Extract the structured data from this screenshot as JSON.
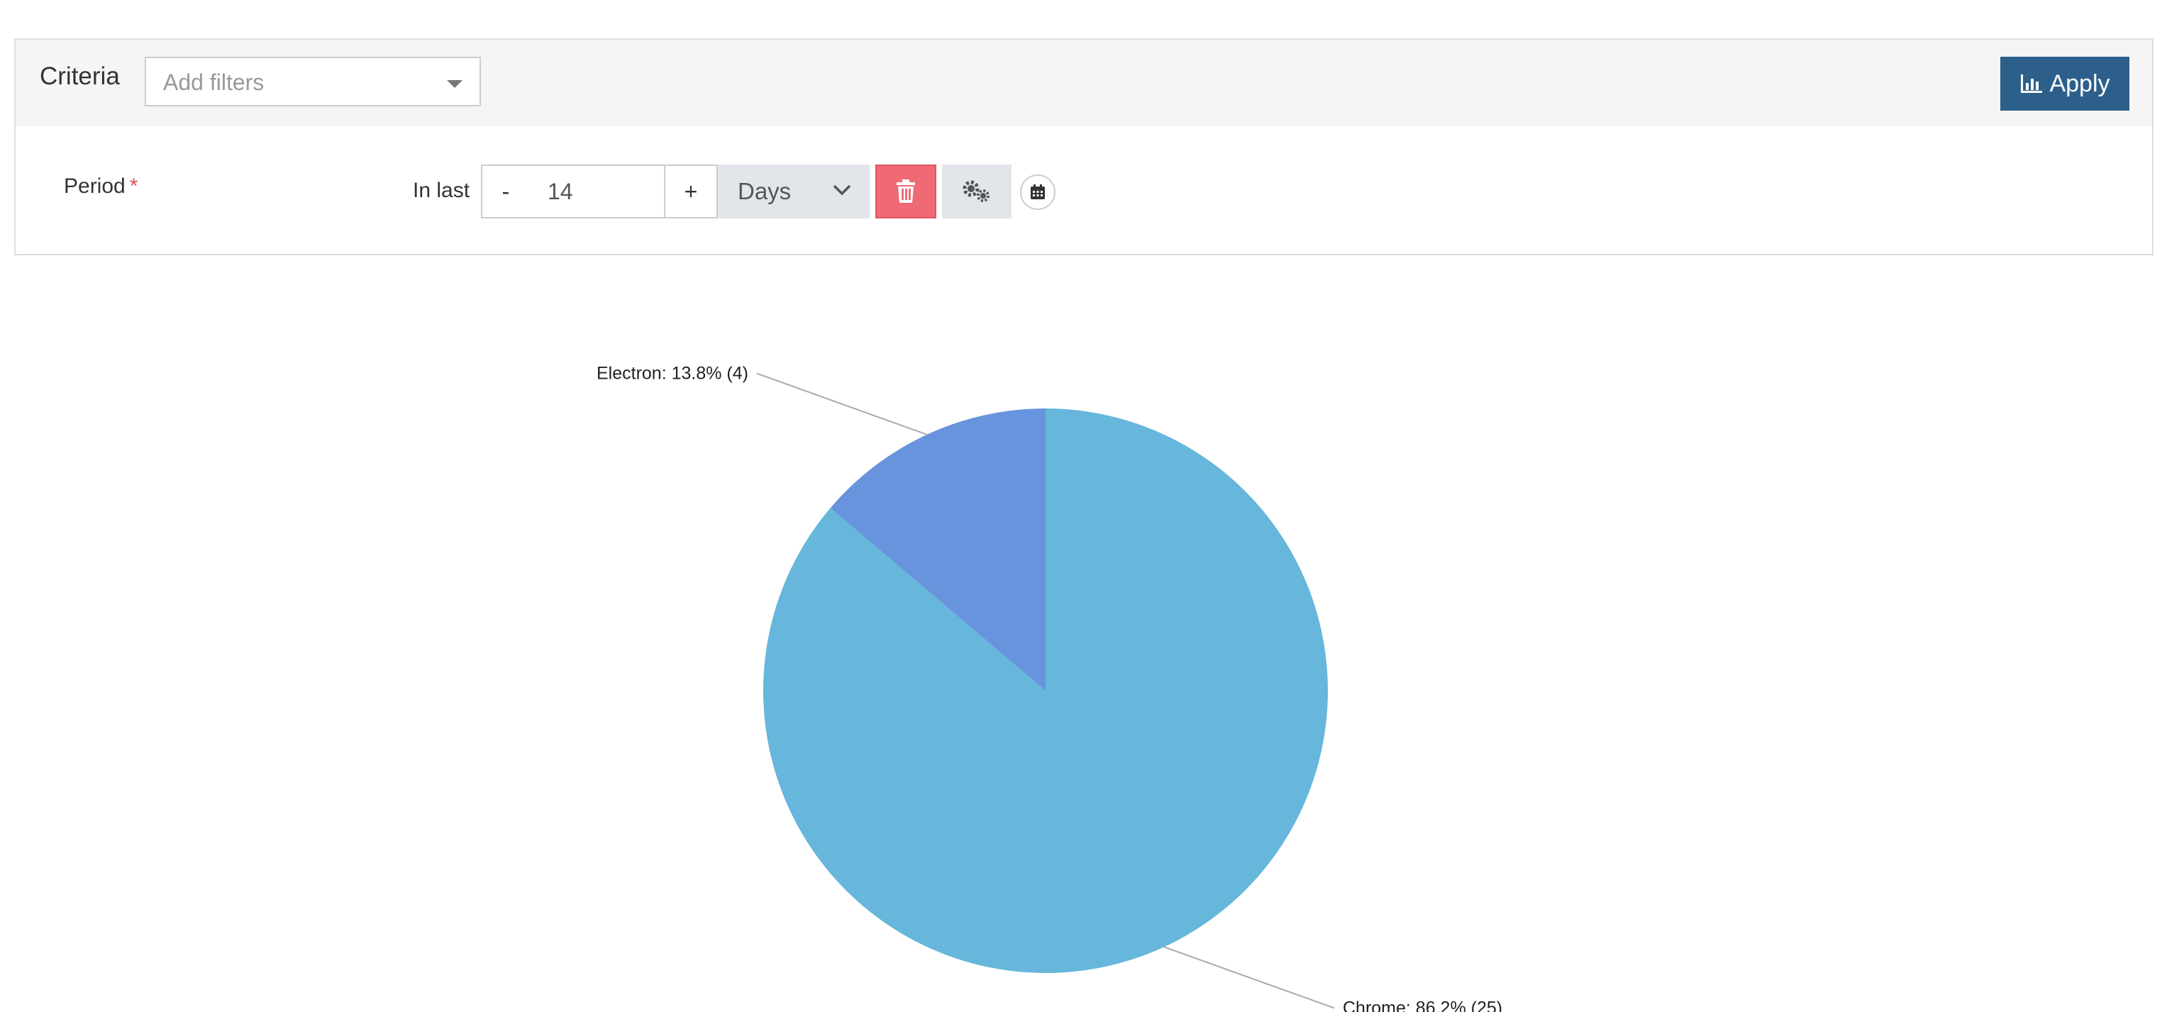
{
  "criteria": {
    "title": "Criteria",
    "filter_placeholder": "Add filters",
    "apply_label": "Apply"
  },
  "period": {
    "label": "Period",
    "required_marker": "*",
    "in_last_label": "In last",
    "minus_label": "-",
    "plus_label": "+",
    "value": "14",
    "unit": "Days"
  },
  "icons": {
    "apply": "bar-chart-icon",
    "unit": "chevron-down-icon",
    "delete": "trash-icon",
    "settings": "gears-icon",
    "calendar": "calendar-icon"
  },
  "colors": {
    "apply_button": "#2d5f8b",
    "delete_button": "#ef6a74",
    "required": "#d9534f"
  },
  "chart_data": {
    "type": "pie",
    "slices": [
      {
        "name": "Chrome",
        "value": 25,
        "percent": 86.2,
        "label": "Chrome: 86.2% (25)",
        "color": "#67b6dc"
      },
      {
        "name": "Electron",
        "value": 4,
        "percent": 13.8,
        "label": "Electron: 13.8% (4)",
        "color": "#6794dc"
      }
    ],
    "start_angle_deg": 0,
    "direction": "clockwise"
  }
}
